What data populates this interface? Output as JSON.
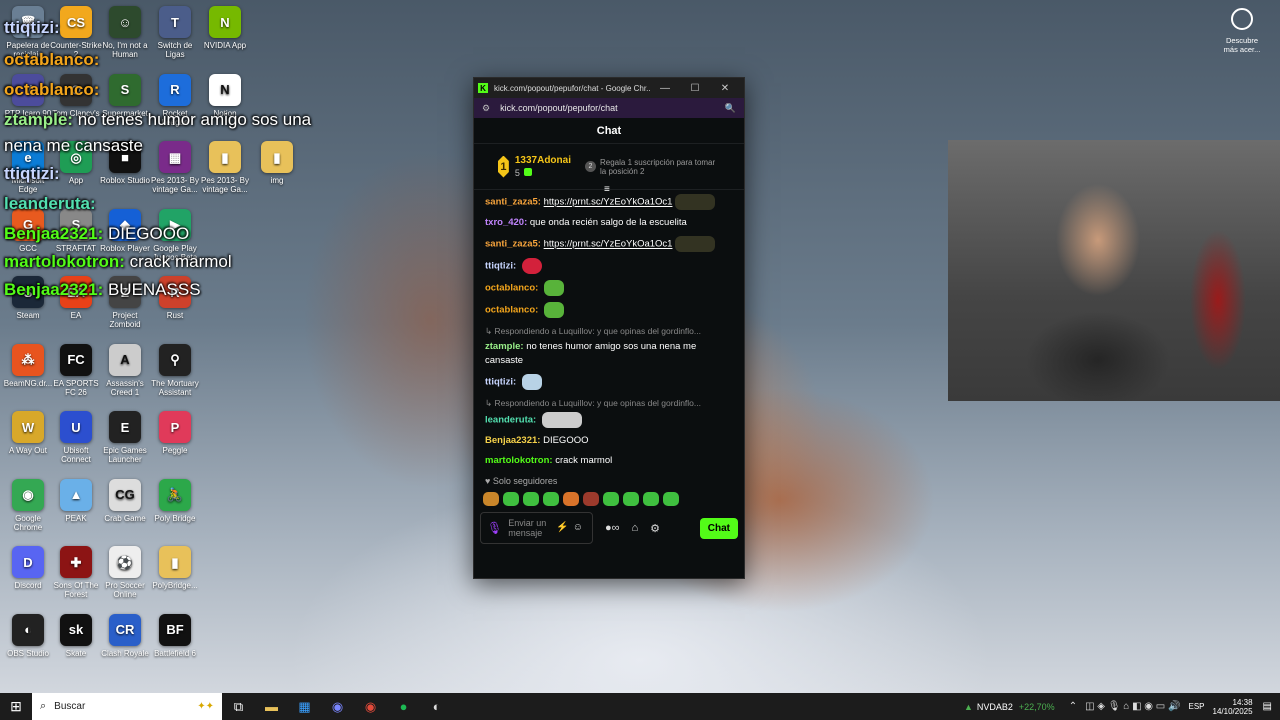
{
  "desktop_icons": [
    {
      "label": "Papelera de reciclaje",
      "color": "#6a7f94",
      "glyph": "🗑"
    },
    {
      "label": "Counter-Strike 2",
      "color": "#f2a81d",
      "glyph": "CS"
    },
    {
      "label": "No, I'm not a Human",
      "color": "#2d4a2d",
      "glyph": "☺"
    },
    {
      "label": "Switch de Ligas",
      "color": "#4b5d8a",
      "glyph": "T"
    },
    {
      "label": "NVIDIA App",
      "color": "#76b900",
      "glyph": "N"
    },
    {
      "label": "PTP Icaro 90",
      "color": "#4c4c9c",
      "glyph": "V"
    },
    {
      "label": "Tom Clancy's",
      "color": "#333",
      "glyph": "⊙"
    },
    {
      "label": "Supermarket",
      "color": "#2f6b2f",
      "glyph": "S"
    },
    {
      "label": "Rocket League",
      "color": "#1d6ddb",
      "glyph": "R"
    },
    {
      "label": "Notion",
      "color": "#fff",
      "glyph": "N"
    },
    {
      "label": "Microsoft Edge",
      "color": "#0b7cd6",
      "glyph": "e"
    },
    {
      "label": "App",
      "color": "#1f9d55",
      "glyph": "◎"
    },
    {
      "label": "Roblox Studio",
      "color": "#111",
      "glyph": "■"
    },
    {
      "label": "Pes 2013- By vintage Ga...",
      "color": "#7a2b8a",
      "glyph": "▦"
    },
    {
      "label": "Pes 2013- By vintage Ga...",
      "color": "#e8c15a",
      "glyph": "▮"
    },
    {
      "label": "img",
      "color": "#e8c15a",
      "glyph": "▮"
    },
    {
      "label": "GCC",
      "color": "#e85a1f",
      "glyph": "G"
    },
    {
      "label": "STRAFTAT",
      "color": "#888",
      "glyph": "S"
    },
    {
      "label": "Roblox Player",
      "color": "#1560d6",
      "glyph": "◆"
    },
    {
      "label": "Google Play Juegos Beta",
      "color": "#21a366",
      "glyph": "▶"
    },
    {
      "label": "Steam",
      "color": "#1b2838",
      "glyph": "S"
    },
    {
      "label": "EA",
      "color": "#e84118",
      "glyph": "EA"
    },
    {
      "label": "Project Zomboid",
      "color": "#444",
      "glyph": "Z"
    },
    {
      "label": "Rust",
      "color": "#cd412b",
      "glyph": "R"
    },
    {
      "label": "BeamNG.dr...",
      "color": "#e8541f",
      "glyph": "⁂"
    },
    {
      "label": "EA SPORTS FC 26",
      "color": "#111",
      "glyph": "FC"
    },
    {
      "label": "Assassin's Creed 1",
      "color": "#ccc",
      "glyph": "A"
    },
    {
      "label": "The Mortuary Assistant",
      "color": "#222",
      "glyph": "⚲"
    },
    {
      "label": "A Way Out",
      "color": "#d8a82a",
      "glyph": "W"
    },
    {
      "label": "Ubisoft Connect",
      "color": "#2c4fcf",
      "glyph": "U"
    },
    {
      "label": "Epic Games Launcher",
      "color": "#222",
      "glyph": "E"
    },
    {
      "label": "Peggle",
      "color": "#e03a5a",
      "glyph": "P"
    },
    {
      "label": "Google Chrome",
      "color": "#34a853",
      "glyph": "◉"
    },
    {
      "label": "PEAK",
      "color": "#6ab0e8",
      "glyph": "▲"
    },
    {
      "label": "Crab Game",
      "color": "#ddd",
      "glyph": "CG"
    },
    {
      "label": "Poly Bridge",
      "color": "#2ca84a",
      "glyph": "🚴"
    },
    {
      "label": "Discord",
      "color": "#5865f2",
      "glyph": "D"
    },
    {
      "label": "Sons Of The Forest",
      "color": "#8c1414",
      "glyph": "✚"
    },
    {
      "label": "Pro Soccer Online",
      "color": "#eee",
      "glyph": "⚽"
    },
    {
      "label": "PolyBridge...",
      "color": "#e8c15a",
      "glyph": "▮"
    },
    {
      "label": "OBS Studio",
      "color": "#222",
      "glyph": "◐"
    },
    {
      "label": "Skate",
      "color": "#111",
      "glyph": "sk"
    },
    {
      "label": "Clash Royale",
      "color": "#2a5fc9",
      "glyph": "CR"
    },
    {
      "label": "Battlefield 6",
      "color": "#111",
      "glyph": "BF"
    }
  ],
  "overlay_chat": [
    {
      "user": "ttiqtizi:",
      "text": "",
      "color": "#c8d6ff"
    },
    {
      "user": "octablanco:",
      "text": "",
      "color": "#f3a51c"
    },
    {
      "user": "octablanco:",
      "text": "",
      "color": "#f3a51c"
    },
    {
      "user": "ztample:",
      "text": "no tenes humor amigo sos una",
      "color": "#9af08a"
    },
    {
      "user": "",
      "text": "nena me cansaste",
      "color": "#fff"
    },
    {
      "user": "ttiqtizi:",
      "text": "",
      "color": "#c8d6ff"
    },
    {
      "user": "leanderuta:",
      "text": "",
      "color": "#53e0b0"
    },
    {
      "user": "Benjaa2321:",
      "text": "DIEGOOO",
      "color": "#53fc18"
    },
    {
      "user": "martolokotron:",
      "text": "crack marmol",
      "color": "#53fc18"
    },
    {
      "user": "Benjaa2321:",
      "text": "BUENASSS",
      "color": "#53fc18"
    }
  ],
  "browser": {
    "title": "kick.com/popout/pepufor/chat - Google Chr...",
    "url": "kick.com/popout/pepufor/chat"
  },
  "chat": {
    "header": "Chat",
    "leader": {
      "rank": "1",
      "name": "1337Adonai",
      "count": "5"
    },
    "gift": {
      "num": "2",
      "text": "Regala 1 suscripción para tomar la posición 2"
    },
    "messages": [
      {
        "user": "santi_zaza5:",
        "color": "#f7a43c",
        "link": "https://prnt.sc/YzEoYkOa1Oc1",
        "text": ""
      },
      {
        "user": "txro_420:",
        "color": "#c084fc",
        "link": "",
        "text": "que onda recién salgo de la escuelita"
      },
      {
        "user": "santi_zaza5:",
        "color": "#f7a43c",
        "link": "https://prnt.sc/YzEoYkOa1Oc1",
        "text": ""
      },
      {
        "user": "ttiqtizi:",
        "color": "#c8d6ff",
        "link": "",
        "text": ""
      },
      {
        "user": "octablanco:",
        "color": "#f3a51c",
        "link": "",
        "text": ""
      },
      {
        "user": "octablanco:",
        "color": "#f3a51c",
        "link": "",
        "text": ""
      },
      {
        "reply": "Respondiendo a Luquillov: y que opinas del gordinflo...",
        "user": "ztample:",
        "color": "#9af08a",
        "link": "",
        "text": "no tenes humor amigo sos una nena me cansaste"
      },
      {
        "user": "ttiqtizi:",
        "color": "#c8d6ff",
        "link": "",
        "text": ""
      },
      {
        "reply": "Respondiendo a Luquillov: y que opinas del gordinflo...",
        "user": "leanderuta:",
        "color": "#53e0b0",
        "link": "",
        "text": ""
      },
      {
        "user": "Benjaa2321:",
        "color": "#f5d14a",
        "link": "",
        "text": "DIEGOOO"
      },
      {
        "user": "martolokotron:",
        "color": "#53fc18",
        "link": "",
        "text": "crack marmol"
      }
    ],
    "followers_only": "Solo seguidores",
    "input_placeholder": "Enviar un mensaje",
    "send_label": "Chat"
  },
  "top_right_icon": {
    "label": "Descubre más acer..."
  },
  "taskbar": {
    "search_placeholder": "Buscar",
    "stock_name": "NVDAB2",
    "stock_change": "+22,70%",
    "lang": "ESP",
    "time": "14:38",
    "date": "14/10/2025"
  }
}
